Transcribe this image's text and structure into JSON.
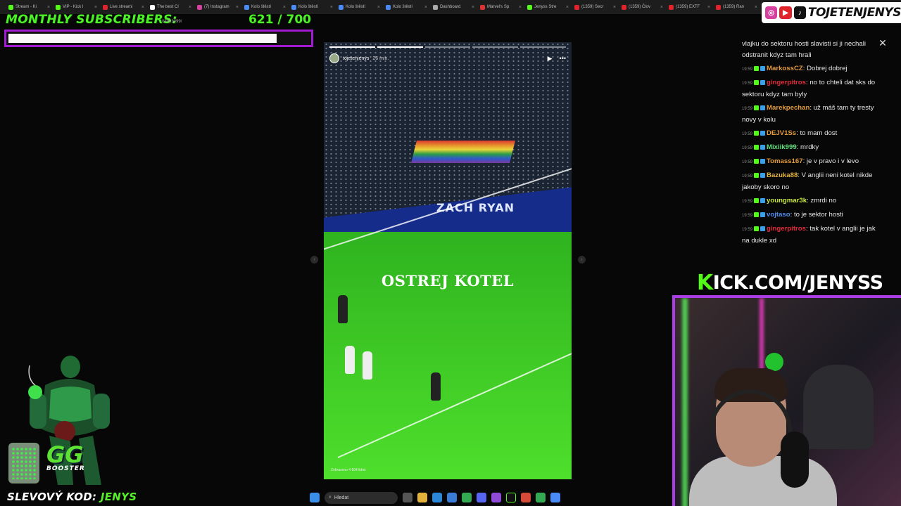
{
  "tabs": [
    {
      "label": "Stream - Ki",
      "color": "#53fc18"
    },
    {
      "label": "VIP - Kick I",
      "color": "#53fc18"
    },
    {
      "label": "Live streami",
      "color": "#e0242b"
    },
    {
      "label": "The best Cl",
      "color": "#ffffff"
    },
    {
      "label": "(7) Instagram",
      "color": "#d6409f"
    },
    {
      "label": "Kolo štěstí",
      "color": "#4a8af4"
    },
    {
      "label": "Kolo štěstí",
      "color": "#4a8af4"
    },
    {
      "label": "Kolo štěstí",
      "color": "#4a8af4"
    },
    {
      "label": "Kolo štěstí",
      "color": "#4a8af4"
    },
    {
      "label": "Dashboard",
      "color": "#aaaaaa"
    },
    {
      "label": "Marvel's Sp",
      "color": "#d33"
    },
    {
      "label": "Jenyss Stre",
      "color": "#53fc18"
    },
    {
      "label": "(1359) Secr",
      "color": "#e0242b"
    },
    {
      "label": "(1359) Člov",
      "color": "#e0242b"
    },
    {
      "label": "(1359) EXTF",
      "color": "#e0242b"
    },
    {
      "label": "(1359) Ran",
      "color": "#e0242b"
    }
  ],
  "social": {
    "handle": "TOJETENJENYS"
  },
  "subgoal": {
    "label": "MONTHLY SUBSCRIBERS:",
    "count": "621  / 700",
    "progress": 0.887,
    "url_fragment": "03403099/"
  },
  "story": {
    "username": "tojetenjenys",
    "time": "26 min.",
    "caption": "OSTREJ KOTEL",
    "board_text": "ZACH   RYAN",
    "segments": [
      1,
      1,
      0,
      0,
      0
    ],
    "seen": "Zobrazeno 4 604 lidmi"
  },
  "chat": {
    "intro": "vlajku do sektoru hosti slavisti si ji nechali odstranit kdyz tam hrali",
    "messages": [
      {
        "ts": "19:59",
        "user": "MarkossCZ",
        "color": "#e39b3b",
        "text": ": Dobrej dobrej"
      },
      {
        "ts": "19:59",
        "user": "gingerpitros",
        "color": "#e4293b",
        "text": ": no to chteli dat sks do sektoru kdyz tam byly"
      },
      {
        "ts": "19:59",
        "user": "Marekpechan",
        "color": "#e39b3b",
        "text": ": už máš tam ty tresty novy v kolu"
      },
      {
        "ts": "19:59",
        "user": "DEJV1Ss",
        "color": "#e39b3b",
        "text": ": to mam dost"
      },
      {
        "ts": "19:59",
        "user": "Mixiik999",
        "color": "#5ee07a",
        "text": ": mrdky"
      },
      {
        "ts": "19:59",
        "user": "Tomass167",
        "color": "#e39b3b",
        "text": ": je v pravo i v levo"
      },
      {
        "ts": "19:59",
        "user": "Bazuka88",
        "color": "#e3b43b",
        "text": ": V anglii neni kotel nikde jakoby skoro no"
      },
      {
        "ts": "19:59",
        "user": "youngmar3k",
        "color": "#c9e83b",
        "text": ": zmrdi no"
      },
      {
        "ts": "19:59",
        "user": "vojtaso",
        "color": "#4f8df0",
        "text": ": to je sektor hosti"
      },
      {
        "ts": "19:59",
        "user": "gingerpitros",
        "color": "#e4293b",
        "text": ": tak kotel v anglii je jak na dukle xd"
      }
    ]
  },
  "kick": {
    "k": "K",
    "rest": "ICK.COM/JENYSS"
  },
  "booster": {
    "brand": "GG",
    "sub": "BOOSTER"
  },
  "promo": {
    "label": "SLEVOVÝ KOD:",
    "code": "JENYS"
  },
  "taskbar": {
    "search_placeholder": "Hledat"
  }
}
